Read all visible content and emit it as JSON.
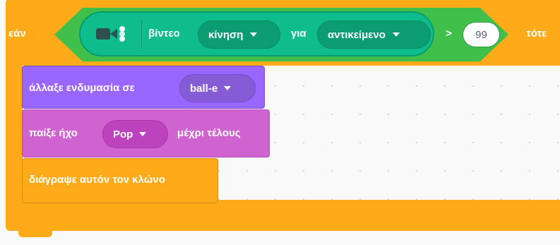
{
  "control_if": {
    "if_label": "εάν",
    "then_label": "τότε",
    "color": "#ffab19"
  },
  "condition": {
    "operator": ">",
    "operator_color": "#40bf4a",
    "reporter": {
      "icon": "video-sensing-icon",
      "label_video": "βίντεο",
      "attribute_dropdown": "κίνηση",
      "label_for": "για",
      "target_dropdown": "αντικείμενο",
      "color": "#0fbd8c"
    },
    "compare_value": "99"
  },
  "blocks": {
    "switch_costume": {
      "label": "άλλαξε ενδυμασία σε",
      "costume_dropdown": "ball-e",
      "color": "#9966ff"
    },
    "play_sound": {
      "label": "παίξε ήχο",
      "sound_dropdown": "Pop",
      "label_suffix": "μέχρι τέλους",
      "color": "#cf63cf"
    },
    "delete_clone": {
      "label": "διάγραψε αυτόν τον κλώνο",
      "color": "#ffab19"
    }
  }
}
